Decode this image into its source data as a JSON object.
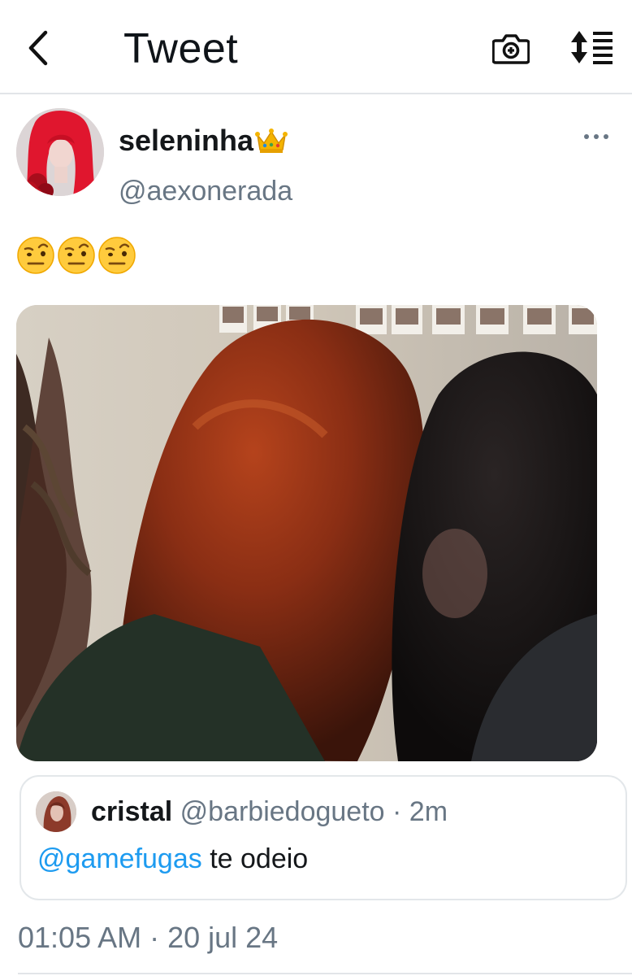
{
  "header": {
    "title": "Tweet",
    "back_icon": "chevron-left-icon",
    "camera_icon": "camera-plus-icon",
    "sort_icon": "sort-list-icon"
  },
  "tweet": {
    "author": {
      "display_name": "seleninha",
      "name_emoji": "crown-icon",
      "handle": "@aexonerada"
    },
    "more_icon": "more-dots-icon",
    "text_emojis": [
      "face-with-raised-eyebrow",
      "face-with-raised-eyebrow",
      "face-with-raised-eyebrow"
    ],
    "timestamp": "01:05 AM · 20 jul 24"
  },
  "quoted": {
    "name": "cristal",
    "handle": "@barbiedogueto",
    "age": " · 2m",
    "mention": "@gamefugas",
    "text": " te odeio"
  },
  "colors": {
    "link": "#1d9bf0",
    "secondary_text": "#687684",
    "divider": "#e2e5e8"
  }
}
